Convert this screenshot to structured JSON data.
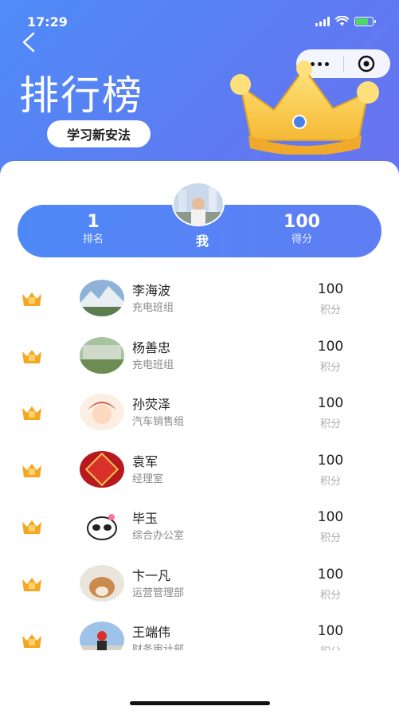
{
  "status_bar": {
    "time": "17:29"
  },
  "header": {
    "title": "排行榜",
    "subtitle": "学习新安法"
  },
  "icons": {
    "back": "chevron-left-icon",
    "more": "more-dots-icon",
    "close": "target-circle-icon",
    "crown": "crown-icon",
    "rank": "rank-crown-icon"
  },
  "colors": {
    "accent": "#4f8cf7",
    "crown_gold": "#f5b935",
    "rank_badge": "#f5a623"
  },
  "me": {
    "rank_value": "1",
    "rank_label": "排名",
    "label": "我",
    "score_value": "100",
    "score_label": "得分"
  },
  "leaderboard": [
    {
      "rank": "1",
      "name": "李海波",
      "dept": "充电班组",
      "score": "100",
      "unit": "积分"
    },
    {
      "rank": "1",
      "name": "杨善忠",
      "dept": "充电班组",
      "score": "100",
      "unit": "积分"
    },
    {
      "rank": "1",
      "name": "孙荧泽",
      "dept": "汽车销售组",
      "score": "100",
      "unit": "积分"
    },
    {
      "rank": "1",
      "name": "袁军",
      "dept": "经理室",
      "score": "100",
      "unit": "积分"
    },
    {
      "rank": "1",
      "name": "毕玉",
      "dept": "综合办公室",
      "score": "100",
      "unit": "积分"
    },
    {
      "rank": "1",
      "name": "卞一凡",
      "dept": "运营管理部",
      "score": "100",
      "unit": "积分"
    },
    {
      "rank": "1",
      "name": "王端伟",
      "dept": "财务审计部",
      "score": "100",
      "unit": "积分"
    }
  ]
}
